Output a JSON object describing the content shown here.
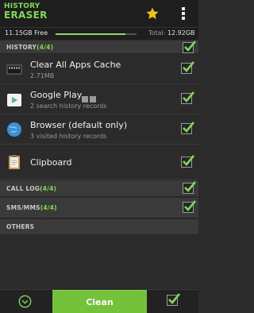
{
  "app": {
    "logo_line1": "HISTORY",
    "logo_line2": "ERASER",
    "accent": "#7fd957"
  },
  "storage": {
    "free_text": "11.15GB Free",
    "total_label": "Total:",
    "total_value": "12.92GB",
    "used_fraction": 0.14
  },
  "sections": {
    "history": {
      "title": "HISTORY",
      "count": "(4/4)"
    },
    "calllog": {
      "title": "CALL LOG",
      "count": "(4/4)"
    },
    "sms": {
      "title": "SMS/MMS",
      "count": "(4/4)"
    },
    "others": {
      "title": "OTHERS"
    }
  },
  "items": [
    {
      "name": "Clear All Apps Cache",
      "sub": "2.71MB",
      "icon": "sd-card-icon"
    },
    {
      "name": "Google Play",
      "sub": "2 search history records",
      "icon": "google-play-icon"
    },
    {
      "name": "Browser (default only)",
      "sub": "3 visited history records",
      "icon": "globe-icon"
    },
    {
      "name": "Clipboard",
      "sub": "",
      "icon": "clipboard-icon"
    }
  ],
  "bottom": {
    "clean_label": "Clean"
  }
}
